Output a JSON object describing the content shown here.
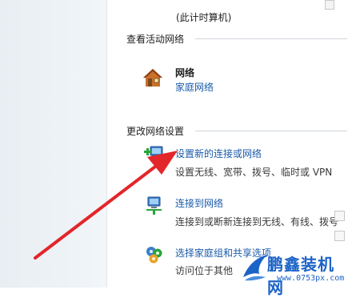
{
  "header": {
    "computer_name": "(此计时算机)"
  },
  "active_networks": {
    "title": "查看活动网络",
    "network_name": "网络",
    "network_type": "家庭网络"
  },
  "change_settings": {
    "title": "更改网络设置",
    "items": [
      {
        "label": "设置新的连接或网络",
        "desc": "设置无线、宽带、拨号、临时或 VPN"
      },
      {
        "label": "连接到网络",
        "desc": "连接到或断新连接到无线、有线、拨号"
      },
      {
        "label": "选择家庭组和共享选项",
        "desc": "访问位于其他"
      }
    ]
  },
  "watermark": {
    "title": "鹏鑫装机网",
    "url": "www.0753px.com"
  },
  "colors": {
    "link": "#1a5aa8",
    "arrow": "#e2262a",
    "watermark": "#1c63c7"
  }
}
